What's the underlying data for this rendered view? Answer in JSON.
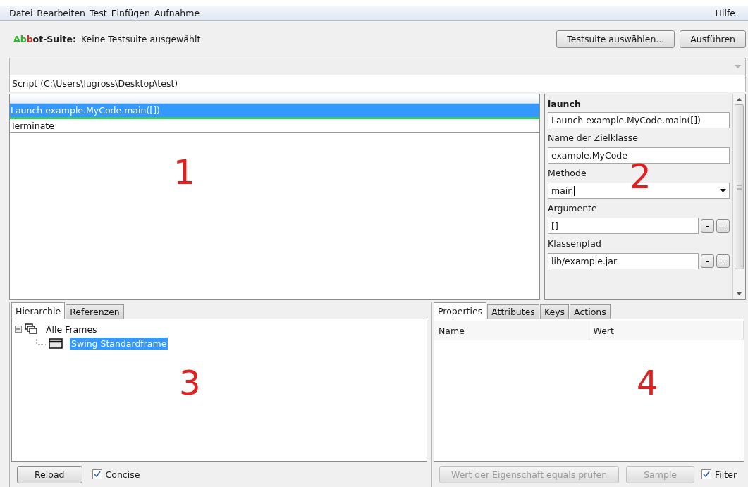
{
  "menu": [
    "Datei",
    "Bearbeiten",
    "Test",
    "Einfügen",
    "Aufnahme"
  ],
  "help_menu": "Hilfe",
  "header": {
    "title_parts": [
      {
        "text": "Ab",
        "color": "#2fae2f"
      },
      {
        "text": "b",
        "color": "#d42a2a"
      },
      {
        "text": "ot-Suite:",
        "color": "#222222"
      }
    ],
    "status": "Keine Testsuite ausgewählt",
    "buttons": [
      "Testsuite auswählen...",
      "Ausführen"
    ]
  },
  "script_label": "Script (C:\\Users\\lugross\\Desktop\\test)",
  "steps": [
    {
      "label": "Launch example.MyCode.main([])",
      "selected": true
    },
    {
      "label": "Terminate",
      "selected": false
    }
  ],
  "steps_annotation": "1",
  "editor": {
    "title": "launch",
    "annotation": "2",
    "fields": [
      {
        "kind": "text",
        "value": "Launch example.MyCode.main([])"
      },
      {
        "kind": "text",
        "label": "Name der Zielklasse",
        "value": "example.MyCode"
      },
      {
        "kind": "combo",
        "label": "Methode",
        "value": "main"
      },
      {
        "kind": "list",
        "label": "Argumente",
        "value": "[]",
        "buttons": [
          "-",
          "+"
        ]
      },
      {
        "kind": "list",
        "label": "Klassenpfad",
        "value": "lib/example.jar",
        "buttons": [
          "-",
          "+"
        ]
      }
    ]
  },
  "hierarchy": {
    "tabs": [
      {
        "label": "Hierarchie",
        "selected": true
      },
      {
        "label": "Referenzen",
        "selected": false
      }
    ],
    "tree": [
      {
        "label": "Alle Frames",
        "expanded": true,
        "selected": false,
        "children": [
          {
            "label": "Swing Standardframe",
            "selected": true
          }
        ]
      }
    ],
    "annotation": "3",
    "reload_button": "Reload",
    "concise": {
      "label": "Concise",
      "checked": true
    }
  },
  "properties": {
    "tabs": [
      {
        "label": "Properties",
        "selected": true
      },
      {
        "label": "Attributes",
        "selected": false
      },
      {
        "label": "Keys",
        "selected": false
      },
      {
        "label": "Actions",
        "selected": false
      }
    ],
    "columns": [
      "Name",
      "Wert"
    ],
    "annotation": "4",
    "buttons": [
      {
        "label": "Wert der Eigenschaft equals prüfen",
        "disabled": true
      },
      {
        "label": "Sample",
        "disabled": true
      }
    ],
    "filter": {
      "label": "Filter",
      "checked": true
    }
  }
}
